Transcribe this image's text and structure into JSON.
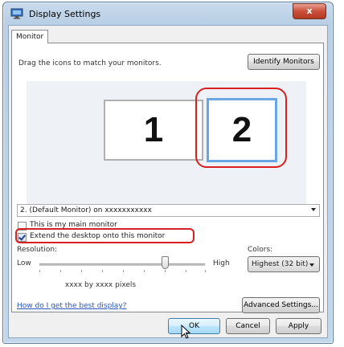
{
  "window": {
    "title": "Display Settings",
    "close_label": "x"
  },
  "tabs": [
    {
      "label": "Monitor"
    }
  ],
  "monitor_tab": {
    "instruction": "Drag the icons to match your monitors.",
    "identify_button": "Identify Monitors",
    "monitors": [
      {
        "label": "1"
      },
      {
        "label": "2"
      }
    ],
    "selected_monitor": "2. (Default Monitor) on xxxxxxxxxxx",
    "main_monitor_checkbox": {
      "label": "This is my main monitor",
      "checked": false
    },
    "extend_checkbox": {
      "label": "Extend the desktop onto this monitor",
      "checked": true
    },
    "resolution": {
      "label": "Resolution:",
      "low_label": "Low",
      "high_label": "High",
      "level": 0.76,
      "value_text": "xxxx by xxxx pixels"
    },
    "colors": {
      "label": "Colors:",
      "value": "Highest (32 bit)"
    },
    "help_link": "How do I get the best display?",
    "advanced_button": "Advanced Settings..."
  },
  "footer": {
    "ok": "OK",
    "cancel": "Cancel",
    "apply": "Apply"
  },
  "colors": {
    "highlight_ring": "#d92020",
    "selected_monitor_border": "#6aa7e2",
    "link": "#2a56b8"
  }
}
